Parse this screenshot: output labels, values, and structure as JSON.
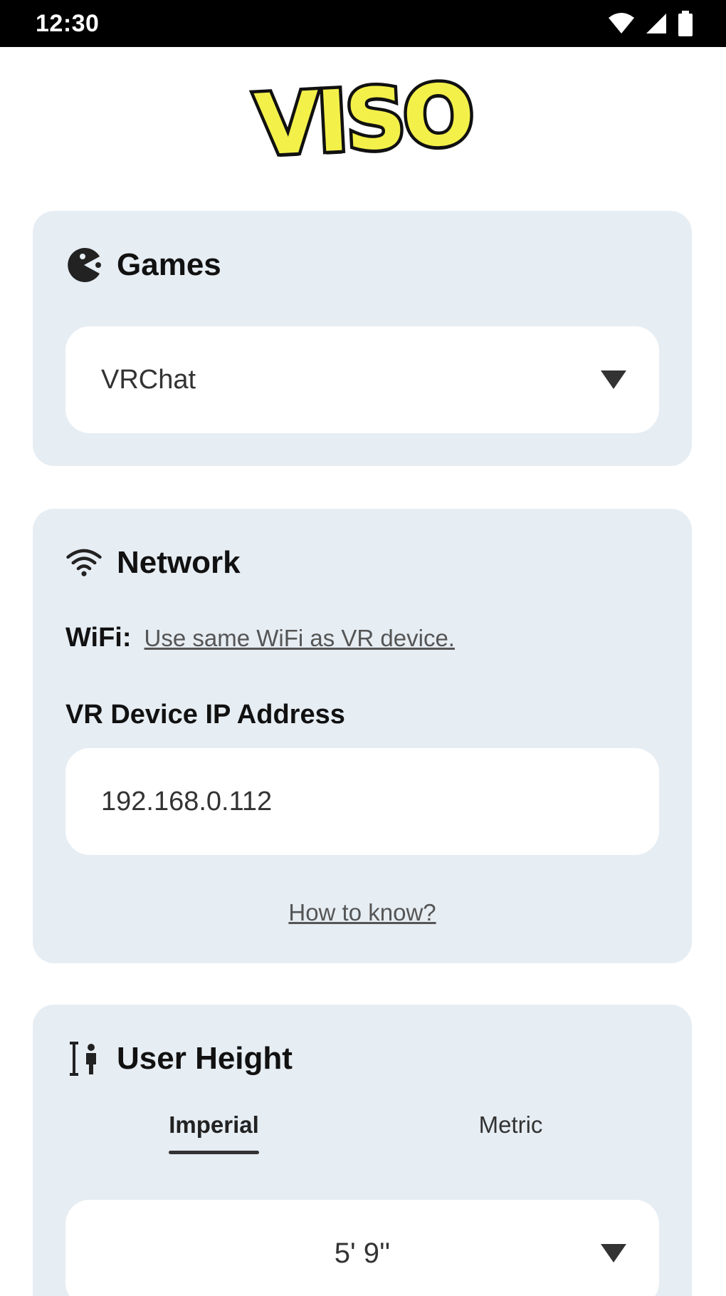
{
  "status_bar": {
    "time": "12:30"
  },
  "logo": {
    "text": "VISO"
  },
  "games": {
    "title": "Games",
    "icon": "pacman-icon",
    "selected": "VRChat"
  },
  "network": {
    "title": "Network",
    "icon": "wifi-icon",
    "wifi_label": "WiFi:",
    "wifi_hint": "Use same WiFi as VR device.",
    "ip_label": "VR Device IP Address",
    "ip_value": "192.168.0.112",
    "how_link": "How to know?"
  },
  "user_height": {
    "title": "User Height",
    "icon": "height-icon",
    "tabs": [
      "Imperial",
      "Metric"
    ],
    "active_tab": "Imperial",
    "value": "5' 9''"
  },
  "colors": {
    "card_bg": "#e6edf3",
    "logo_fill": "#f3f04a",
    "status_bar_bg": "#000000"
  }
}
